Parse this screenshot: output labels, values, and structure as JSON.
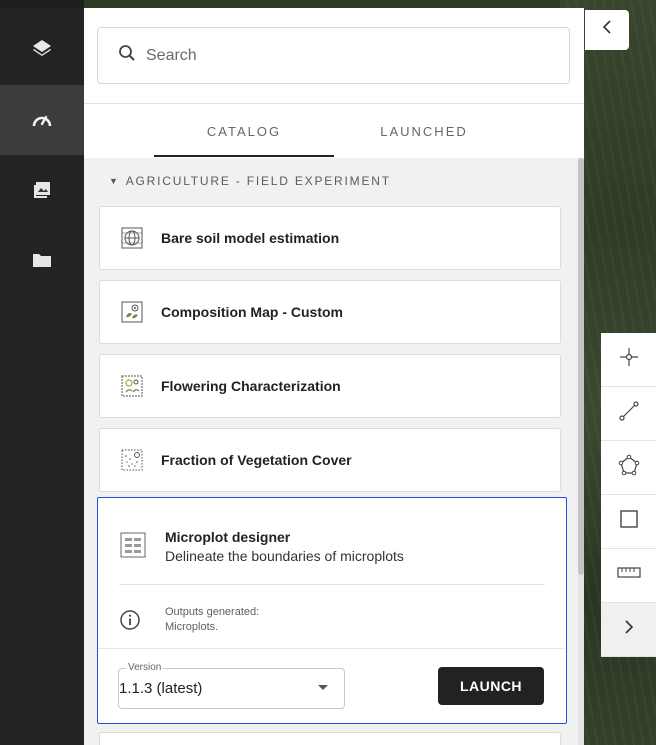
{
  "search": {
    "placeholder": "Search"
  },
  "tabs": [
    {
      "label": "CATALOG",
      "active": true
    },
    {
      "label": "LAUNCHED",
      "active": false
    }
  ],
  "section": {
    "title": "AGRICULTURE - FIELD EXPERIMENT"
  },
  "items": [
    {
      "label": "Bare soil model estimation",
      "icon": "globe-grid-icon"
    },
    {
      "label": "Composition Map - Custom",
      "icon": "leaf-target-icon"
    },
    {
      "label": "Flowering Characterization",
      "icon": "flower-icon"
    },
    {
      "label": "Fraction of Vegetation Cover",
      "icon": "dotted-grid-icon"
    }
  ],
  "selected": {
    "title": "Microplot designer",
    "description": "Delineate the boundaries of microplots",
    "outputs_label": "Outputs generated:",
    "outputs_value": "Microplots.",
    "version_label": "Version",
    "version_value": "1.1.3 (latest)",
    "launch_label": "LAUNCH"
  },
  "colors": {
    "selection_border": "#1f4fe0",
    "rail_bg": "#232323",
    "launch_bg": "#222222"
  }
}
